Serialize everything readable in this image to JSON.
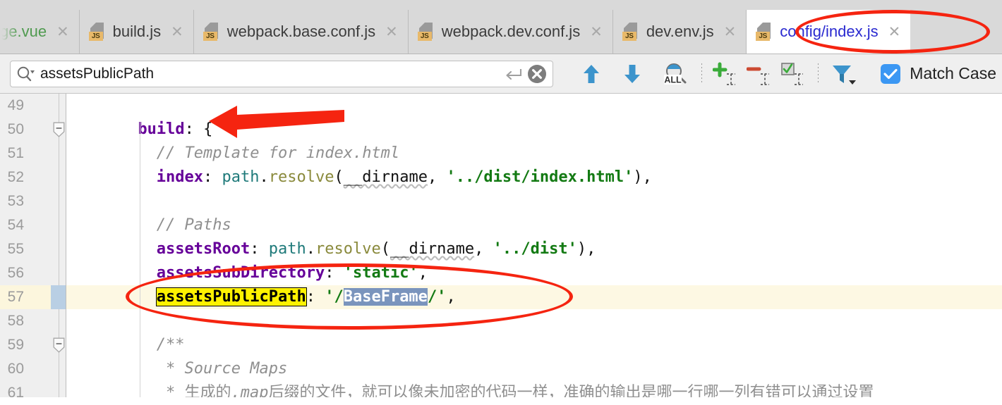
{
  "window": {
    "app": "IDE code editor",
    "accent_blue": "#3b97f3",
    "annotation_red": "#f52410",
    "highlight_yellow": "#fff200",
    "selection_blue": "#7a94bd"
  },
  "tabs": [
    {
      "label": "ge.vue",
      "icon": "vue-file-icon",
      "close": "✕",
      "active": false,
      "clipped": true
    },
    {
      "label": "build.js",
      "icon": "js-file-icon",
      "close": "✕",
      "active": false,
      "clipped": false
    },
    {
      "label": "webpack.base.conf.js",
      "icon": "js-file-icon",
      "close": "✕",
      "active": false,
      "clipped": false
    },
    {
      "label": "webpack.dev.conf.js",
      "icon": "js-file-icon",
      "close": "✕",
      "active": false,
      "clipped": false
    },
    {
      "label": "dev.env.js",
      "icon": "js-file-icon",
      "close": "✕",
      "active": false,
      "clipped": false
    },
    {
      "label": "config/index.js",
      "icon": "js-file-icon",
      "close": "✕",
      "active": true,
      "clipped": false
    }
  ],
  "search": {
    "value": "assetsPublicPath",
    "placeholder": "Search",
    "magnifier_icon": "search-icon",
    "dropdown_icon": "chevron-down-icon",
    "enter_icon": "enter-return-icon",
    "clear_icon": "clear-circle-x-icon",
    "buttons": [
      {
        "name": "find-previous-button",
        "icon": "arrow-up-icon",
        "title": "Previous Occurrence"
      },
      {
        "name": "find-next-button",
        "icon": "arrow-down-icon",
        "title": "Next Occurrence"
      },
      {
        "name": "find-all-button",
        "icon": "search-all-icon",
        "label": "ALL"
      },
      {
        "name": "add-selection-button",
        "icon": "plus-caret-icon"
      },
      {
        "name": "remove-selection-button",
        "icon": "minus-caret-icon"
      },
      {
        "name": "select-all-occurrences-button",
        "icon": "checkbox-caret-icon"
      },
      {
        "name": "filter-button",
        "icon": "filter-funnel-icon"
      }
    ],
    "match_case": {
      "label": "Match Case",
      "checked": true,
      "check_icon": "checkmark-icon"
    }
  },
  "editor": {
    "first_line": 49,
    "highlighted_line": 57,
    "fold_lines": [
      50,
      59
    ],
    "lines": [
      {
        "n": 49,
        "segments": []
      },
      {
        "n": 50,
        "indent": 2,
        "segments": [
          {
            "t": "build",
            "c": "key"
          },
          {
            "t": ": {",
            "c": "plain"
          }
        ]
      },
      {
        "n": 51,
        "indent": 4,
        "segments": [
          {
            "t": "// Template for index.html",
            "c": "com"
          }
        ]
      },
      {
        "n": 52,
        "indent": 4,
        "segments": [
          {
            "t": "index",
            "c": "key"
          },
          {
            "t": ": ",
            "c": "plain"
          },
          {
            "t": "path",
            "c": "obj"
          },
          {
            "t": ".",
            "c": "plain"
          },
          {
            "t": "resolve",
            "c": "fn"
          },
          {
            "t": "(",
            "c": "plain"
          },
          {
            "t": "__dirname",
            "c": "wavy"
          },
          {
            "t": ", ",
            "c": "plain"
          },
          {
            "t": "'../dist/index.html'",
            "c": "str"
          },
          {
            "t": "),",
            "c": "plain"
          }
        ]
      },
      {
        "n": 53,
        "segments": []
      },
      {
        "n": 54,
        "indent": 4,
        "segments": [
          {
            "t": "// Paths",
            "c": "com"
          }
        ]
      },
      {
        "n": 55,
        "indent": 4,
        "segments": [
          {
            "t": "assetsRoot",
            "c": "key"
          },
          {
            "t": ": ",
            "c": "plain"
          },
          {
            "t": "path",
            "c": "obj"
          },
          {
            "t": ".",
            "c": "plain"
          },
          {
            "t": "resolve",
            "c": "fn"
          },
          {
            "t": "(",
            "c": "plain"
          },
          {
            "t": "__dirname",
            "c": "wavy"
          },
          {
            "t": ", ",
            "c": "plain"
          },
          {
            "t": "'../dist'",
            "c": "str"
          },
          {
            "t": "),",
            "c": "plain"
          }
        ]
      },
      {
        "n": 56,
        "indent": 4,
        "segments": [
          {
            "t": "assetsSubDirectory",
            "c": "key"
          },
          {
            "t": ": ",
            "c": "plain"
          },
          {
            "t": "'static'",
            "c": "str"
          },
          {
            "t": ",",
            "c": "plain"
          }
        ]
      },
      {
        "n": 57,
        "indent": 4,
        "segments": [
          {
            "t": "assetsPublicPath",
            "c": "found"
          },
          {
            "t": ": ",
            "c": "plain"
          },
          {
            "t": "'/",
            "c": "str"
          },
          {
            "t": "BaseFrame",
            "c": "sel"
          },
          {
            "t": "/'",
            "c": "str"
          },
          {
            "t": ",",
            "c": "plain"
          }
        ]
      },
      {
        "n": 58,
        "segments": []
      },
      {
        "n": 59,
        "indent": 4,
        "segments": [
          {
            "t": "/**",
            "c": "com"
          }
        ]
      },
      {
        "n": 60,
        "indent": 5,
        "segments": [
          {
            "t": "* Source Maps",
            "c": "com"
          }
        ]
      },
      {
        "n": 61,
        "indent": 5,
        "segments": [
          {
            "t": "* ",
            "c": "com"
          },
          {
            "t": "生成的",
            "c": "zh"
          },
          {
            "t": ".map",
            "c": "com"
          },
          {
            "t": "后缀的文件，就可以像未加密的代码一样，准确的输出是哪一行哪一列有错可以通过设置",
            "c": "zh"
          }
        ]
      }
    ]
  },
  "annotations": [
    {
      "name": "red-ellipse-active-tab",
      "shape": "ellipse",
      "color": "#f52410"
    },
    {
      "name": "red-arrow-build-key",
      "shape": "arrow",
      "color": "#f52410"
    },
    {
      "name": "red-ellipse-assets-public-path",
      "shape": "ellipse",
      "color": "#f52410"
    }
  ]
}
